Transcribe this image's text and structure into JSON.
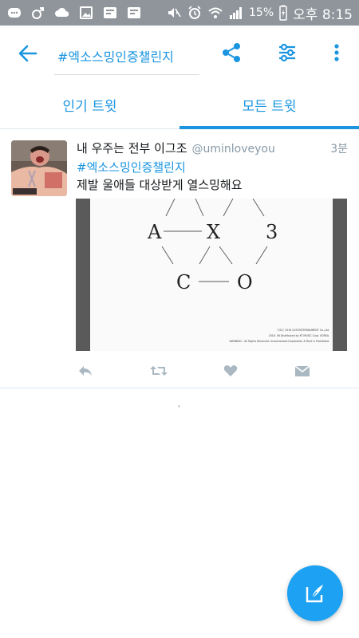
{
  "status_bar": {
    "battery": "15%",
    "time": "오후 8:15"
  },
  "toolbar": {
    "search_query": "#엑소스밍인증챌린지"
  },
  "tabs": [
    {
      "label": "인기 트윗",
      "active": false
    },
    {
      "label": "모든 트윗",
      "active": true
    }
  ],
  "tweet": {
    "name": "내 우주는 전부 이그조",
    "handle": "@uminloveyou",
    "time": "3분",
    "hashtag": "#엑소스밍인증챌린지",
    "text": "제발 울애들 대상받게 열스밍해요",
    "media": {
      "letters": [
        "A",
        "X",
        "3",
        "C",
        "O"
      ],
      "fineprint": [
        "ⓟ&ⓒ 2016 S.M.ENTERTAINMENT Co.,Ltd.",
        "2016. 06 Distributed by KT MUSIC Corp. KOREA.",
        "WARNING : All Rights Reserved. Unauthorized Duplication & Rent is Prohibited."
      ]
    }
  },
  "colors": {
    "accent": "#1b95e0",
    "status_bar": "#8f959b",
    "fab": "#1da1f2",
    "action_icon": "#aab8c2"
  },
  "icons": {
    "back": "arrow-left-icon",
    "share": "share-icon",
    "filter": "sliders-icon",
    "overflow": "more-vertical-icon",
    "reply": "reply-icon",
    "retweet": "retweet-icon",
    "like": "heart-icon",
    "dm": "envelope-icon",
    "compose": "compose-icon"
  }
}
